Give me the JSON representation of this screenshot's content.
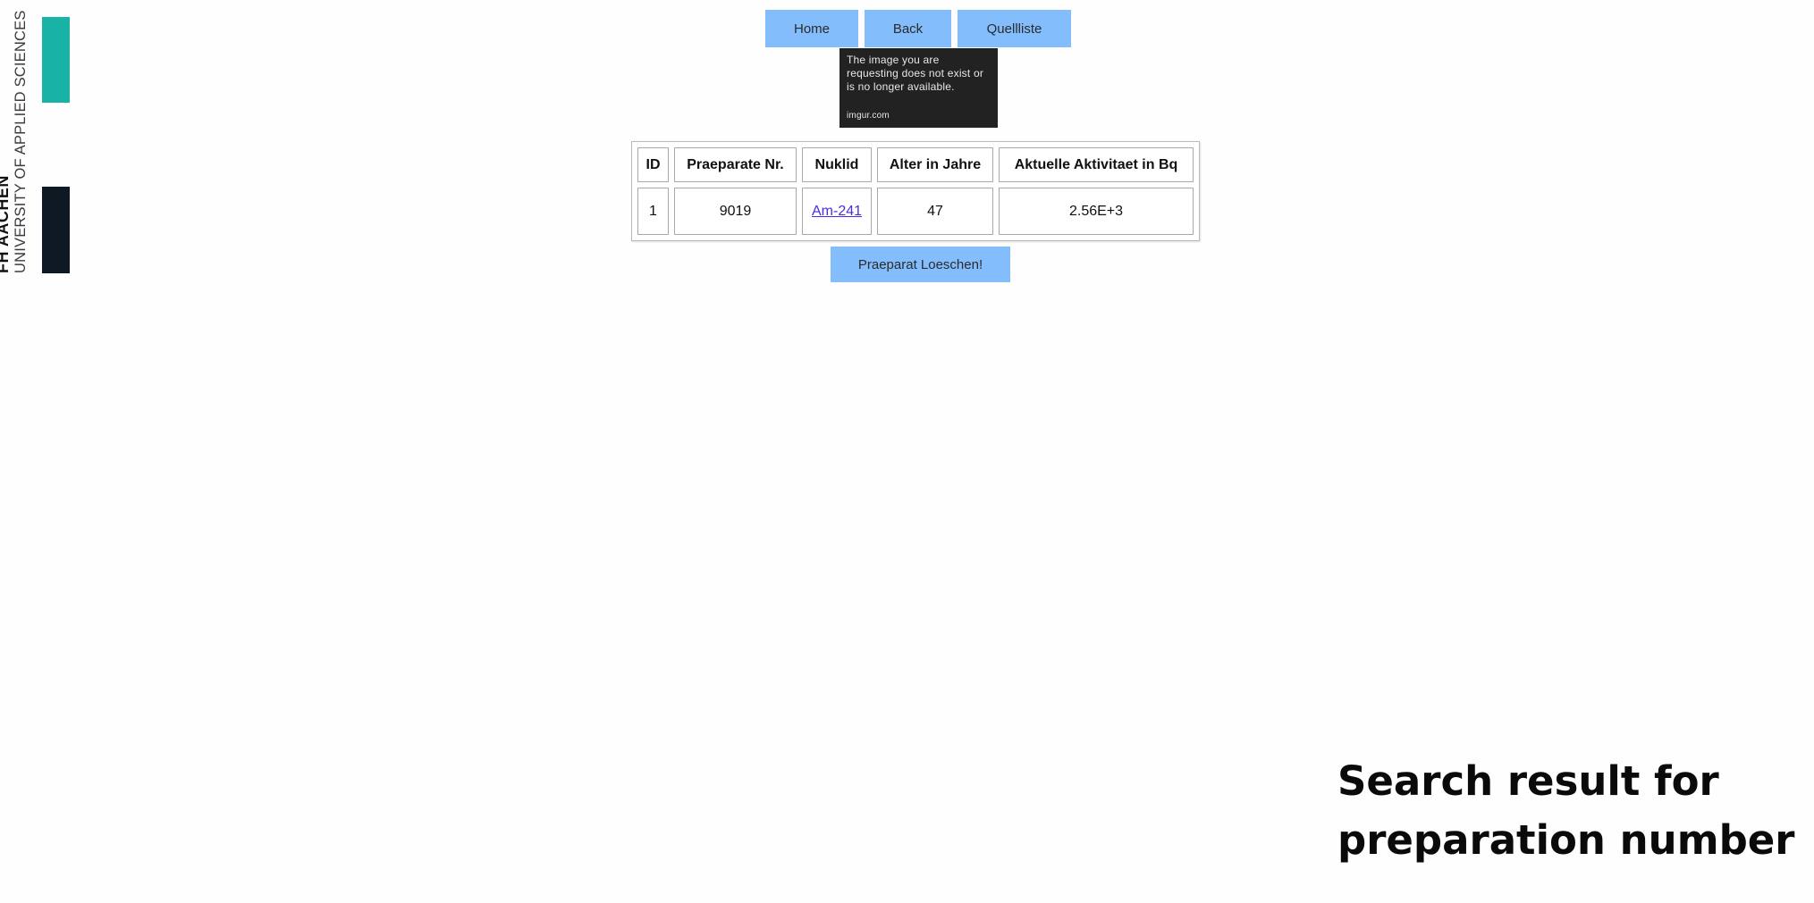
{
  "branding": {
    "name_line1": "FH AACHEN",
    "name_line2": "UNIVERSITY OF APPLIED SCIENCES",
    "colors": {
      "teal": "#19b2a6",
      "dark": "#0f1923"
    }
  },
  "nav": {
    "home_label": "Home",
    "back_label": "Back",
    "quellen_label": "Quellliste",
    "button_color": "#83bdfc"
  },
  "missing_image": {
    "message": "The image you are requesting does not exist or is no longer available.",
    "source": "imgur.com"
  },
  "table": {
    "headers": [
      "ID",
      "Praeparate Nr.",
      "Nuklid",
      "Alter in Jahre",
      "Aktuelle Aktivitaet in Bq"
    ],
    "rows": [
      {
        "id": "1",
        "praeparat_nr": "9019",
        "nuklid": "Am-241",
        "alter": "47",
        "aktivitaet": "2.56E+3"
      }
    ]
  },
  "actions": {
    "delete_label": "Praeparat Loeschen!"
  },
  "caption": {
    "line1": "Search result for",
    "line2": "preparation number"
  },
  "colors": {
    "link": "#4a2de0",
    "button": "#83bdfc"
  }
}
